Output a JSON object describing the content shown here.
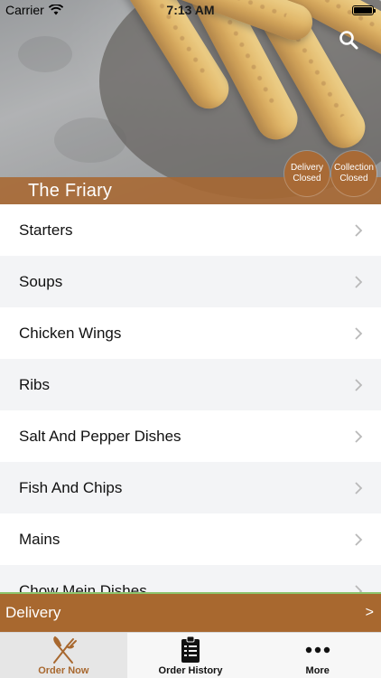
{
  "status_bar": {
    "carrier": "Carrier",
    "time": "7:13 AM"
  },
  "header": {
    "restaurant_name": "The Friary",
    "badges": {
      "delivery": {
        "line1": "Delivery",
        "line2": "Closed"
      },
      "collection": {
        "line1": "Collection",
        "line2": "Closed"
      }
    }
  },
  "menu": {
    "categories": [
      {
        "label": "Starters"
      },
      {
        "label": "Soups"
      },
      {
        "label": "Chicken Wings"
      },
      {
        "label": "Ribs"
      },
      {
        "label": "Salt And Pepper Dishes"
      },
      {
        "label": "Fish And Chips"
      },
      {
        "label": "Mains"
      },
      {
        "label": "Chow Mein Dishes"
      }
    ]
  },
  "order_mode": {
    "label": "Delivery",
    "arrow": ">"
  },
  "tabbar": {
    "tabs": [
      {
        "label": "Order Now",
        "icon": "fork-knife-icon",
        "active": true
      },
      {
        "label": "Order History",
        "icon": "clipboard-list-icon",
        "active": false
      },
      {
        "label": "More",
        "icon": "more-dots-icon",
        "active": false
      }
    ]
  },
  "colors": {
    "accent": "#a8682f",
    "badge": "#a86a36",
    "divider_green": "#8cc46b"
  }
}
